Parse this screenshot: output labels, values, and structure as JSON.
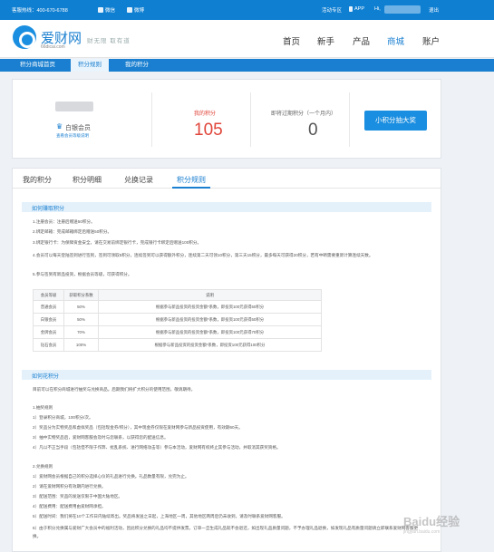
{
  "topbar": {
    "hotline": "客服热线：400-670-6788",
    "wechat": "微信",
    "weibo": "微博",
    "activity": "活动专区",
    "app": "APP",
    "greeting": "Hi,",
    "logout": "退出"
  },
  "header": {
    "logo_text": "爱财网",
    "logo_sub": "66dicai.com",
    "slogan": "财无限  取有道",
    "nav": [
      "首页",
      "新手",
      "产品",
      "商城",
      "账户"
    ]
  },
  "subnav": [
    "积分商城首页",
    "积分规则",
    "我的积分"
  ],
  "summary": {
    "member_level": "白银会员",
    "member_link": "查看会员等级说明",
    "my_points_label": "我的积分",
    "my_points_value": "105",
    "expiring_label": "即将过期积分（一个月内）",
    "expiring_value": "0",
    "draw_button": "小积分抽大奖"
  },
  "tabs": [
    "我的积分",
    "积分明细",
    "兑换记录",
    "积分规则"
  ],
  "earn": {
    "title": "如何赚取积分",
    "lines": [
      "1.注册会员：注册后赠送50积分。",
      "2.绑定邮箱：完成邮箱绑定后赠送50积分。",
      "3.绑定银行卡：为保障资金安全，请在交易前绑定银行卡，完成银行卡绑定后赠送100积分。",
      "4.会员可以每天登陆签到进行签到，签到可领取5积分，连续签到可以获得额外积分，连续第二天可领10积分，第三天15积分，最多每天可获得20积分，若有中断需要重新计算连续天数。",
      "5.参与签到有新品投资，根据会员等级，可获得积分。"
    ]
  },
  "table": {
    "headers": [
      "会员等级",
      "获取积分系数",
      "说明"
    ],
    "rows": [
      [
        "普通会员",
        "50%",
        "根据参与新品投资的投资金额*系数，即投资100元获得50积分"
      ],
      [
        "白银会员",
        "50%",
        "根据参与新品投资的投资金额*系数，即投资100元获得50积分"
      ],
      [
        "金牌会员",
        "70%",
        "根据参与新品投资的投资金额*系数，即投资100元获得70积分"
      ],
      [
        "钻石会员",
        "100%",
        "根据参与新品投资的投资金额*系数，即投资100元获得100积分"
      ]
    ]
  },
  "spend": {
    "title": "如何花积分",
    "intro": "目前可以在积分商城进行抽奖与兑换商品。后期我们将扩大积分的使用范围，敬请期待。",
    "draw_title": "1.抽奖规则",
    "draw_lines": [
      "1）登录积分商城，100积分/次。",
      "2）奖品分为实物奖品和虚拟奖品（包括现金券/积分），其中现金券仅限在爱财网参与新品投资使用，有效期60天。",
      "3）抽中实物奖品后，爱财网客服会及时与您联系，以获得您的配送信息。",
      "4）凡以不正当手段（包括但不限于作弊、扰乱系统、进行网络攻击等）参与本活动，爱财网有权终止其参与活动，并取消其获奖资格。"
    ],
    "exchange_title": "2.兑换规则",
    "exchange_lines": [
      "1）爱财网会员根据自己的积分选择心仪的礼品进行兑换。礼品数量有限，兑完为止。",
      "2）请在爱财网积分有效期内进行兑换。",
      "3）配送范围：奖品的发送仅限于中国大陆地区。",
      "4）配送费用：配送费用由爱财网承担。",
      "5）配送时间：我们将在10个工作日内陆续寄出。奖品将发送之日起，上海地区一周，其他地区两周后仍未收到，请及时联系爱财网客服。",
      "6）由于积分兑换属与爱财广大会员中的福利活动，因此积分兑换的礼品均不提供发票。订单一旦生成礼品就不会退还，如出现礼品质量问题，不予办理礼品退换，如发现礼品有质量问题请立即联系爱财网客服更换。"
    ]
  },
  "watermark": "Baidu经验",
  "watermark_sub": "jingyan.baidu.com"
}
